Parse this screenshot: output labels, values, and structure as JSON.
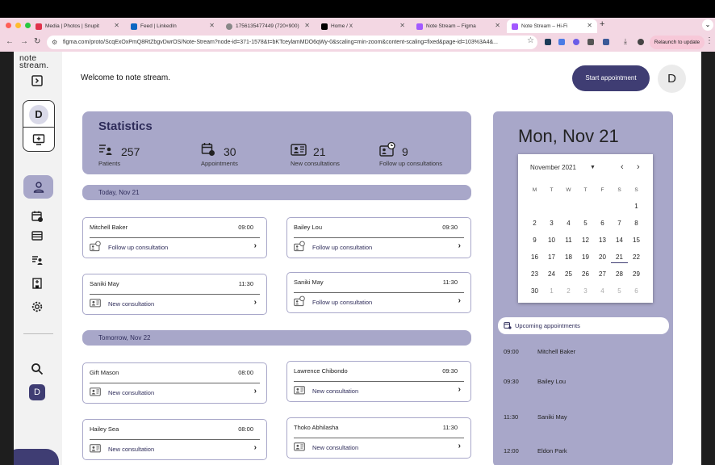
{
  "browser": {
    "tabs": [
      {
        "title": "Media | Photos | Snupit",
        "color": "#e0314b"
      },
      {
        "title": "Feed | LinkedIn",
        "color": "#0a66c2"
      },
      {
        "title": "1756135477449 (720×900)",
        "color": "#888888"
      },
      {
        "title": "Home / X",
        "color": "#000000"
      },
      {
        "title": "Note Stream – Figma",
        "color": "#a259ff"
      },
      {
        "title": "Note Stream – Hi-Fi",
        "color": "#a259ff"
      }
    ],
    "url": "figma.com/proto/ScqExOxPmQ8RtZbgvDwrOS/Note-Stream?node-id=371-1578&t=bKTceylamMDO6qWy-0&scaling=min-zoom&content-scaling=fixed&page-id=103%3A4&...",
    "relaunch_label": "Relaunch to update"
  },
  "app": {
    "logo_line1": "note",
    "logo_line2": "stream.",
    "profile_initial": "D",
    "sidebar_avatar": "D",
    "welcome": "Welcome  to note stream.",
    "start_button": "Start appointment",
    "header_avatar": "D",
    "stats": {
      "title": "Statistics",
      "items": [
        {
          "value": "257",
          "label": "Patients"
        },
        {
          "value": "30",
          "label": "Appointments"
        },
        {
          "value": "21",
          "label": "New consultations"
        },
        {
          "value": "9",
          "label": "Follow up consultations"
        }
      ]
    },
    "today_label": "Today, Nov  21",
    "tomorrow_label": "Tomorrow, Nov  22",
    "today_appointments": [
      {
        "name": "Mitchell Baker",
        "time": "09:00",
        "type": "Follow up consultation"
      },
      {
        "name": "Bailey Lou",
        "time": "09:30",
        "type": "Follow up consultation"
      },
      {
        "name": "Saniki May",
        "time": "11:30",
        "type": "New consultation"
      },
      {
        "name": "Saniki May",
        "time": "11:30",
        "type": "Follow up consultation"
      }
    ],
    "tomorrow_appointments": [
      {
        "name": "Gift Mason",
        "time": "08:00",
        "type": "New consultation"
      },
      {
        "name": "Lawrence Chibondo",
        "time": "09:30",
        "type": "New consultation"
      },
      {
        "name": "Hailey Sea",
        "time": "08:00",
        "type": "New consultation"
      },
      {
        "name": "Thoko  Abhilasha",
        "time": "11:30",
        "type": "New consultation"
      }
    ],
    "calendar": {
      "date_heading": "Mon, Nov 21",
      "month_label": "November 2021",
      "weekdays": [
        "M",
        "T",
        "W",
        "T",
        "F",
        "S",
        "S"
      ],
      "rows": [
        [
          "",
          "",
          "",
          "",
          "",
          "",
          "1"
        ],
        [
          "2",
          "3",
          "4",
          "5",
          "6",
          "7",
          "8"
        ],
        [
          "9",
          "10",
          "11",
          "12",
          "13",
          "14",
          "15"
        ],
        [
          "16",
          "17",
          "18",
          "19",
          "20",
          "21",
          "22"
        ],
        [
          "23",
          "24",
          "25",
          "26",
          "27",
          "28",
          "29"
        ],
        [
          "30",
          "1",
          "2",
          "3",
          "4",
          "5",
          "6"
        ]
      ],
      "selected": "21"
    },
    "upcoming": {
      "label": "Upcoming  appointments",
      "items": [
        {
          "time": "09:00",
          "name": "Mitchell Baker"
        },
        {
          "time": "09:30",
          "name": "Bailey Lou"
        },
        {
          "time": "11:30",
          "name": "Saniki May"
        },
        {
          "time": "12:00",
          "name": "Eldon Park"
        }
      ]
    },
    "colors": {
      "accent": "#3f3d73",
      "lavender": "#a8a7c9",
      "sidebar_bg": "#f2f2f2"
    }
  }
}
